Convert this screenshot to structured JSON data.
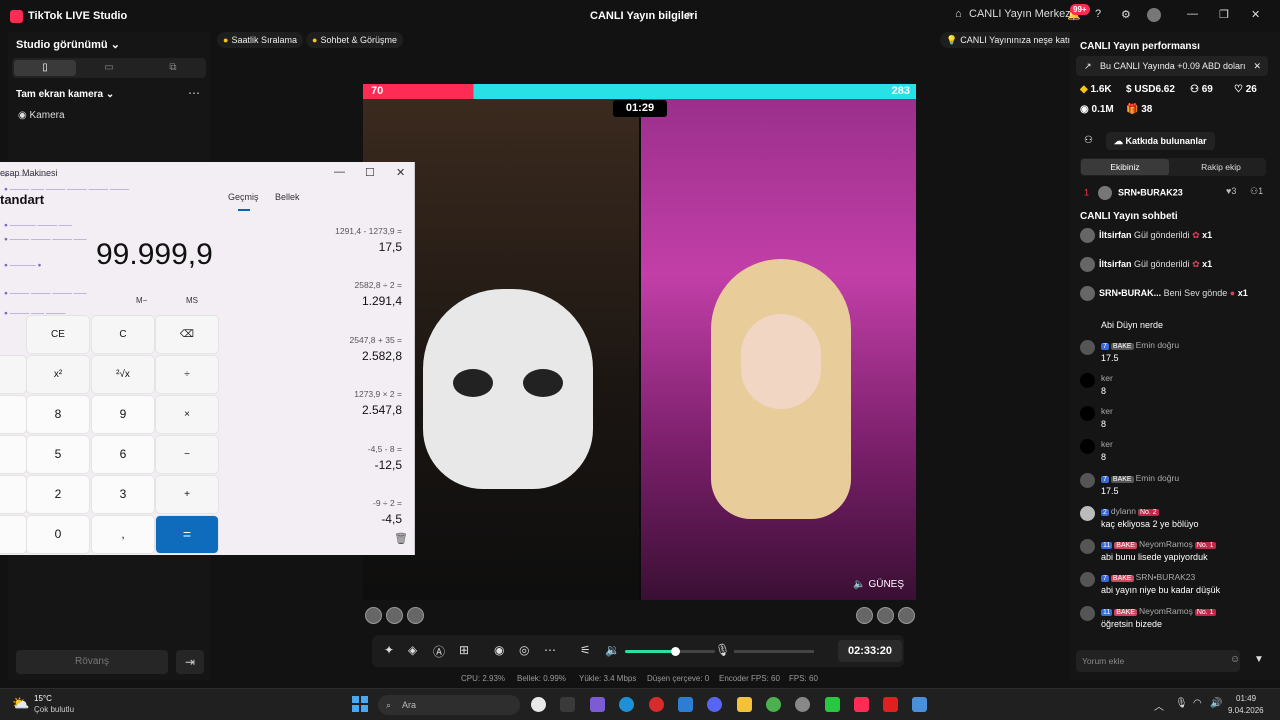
{
  "titlebar": {
    "app_name": "TikTok LIVE Studio",
    "live_info": "CANLI Yayın bilgileri",
    "edit_icon": "⇗",
    "live_center": "CANLI Yayın Merkezi",
    "notif_badge": "99+"
  },
  "left": {
    "studio_view": "Studio görünümü",
    "fullscreen_camera": "Tam ekran kamera",
    "camera_label": "Kamera",
    "rematch_button": "Rövanş"
  },
  "chips": {
    "hourly_ranking": "Saatlik Sıralama",
    "chat_meeting": "Sohbet & Görüşme",
    "tip": "CANLI Yayınınıza neşe katın"
  },
  "stage": {
    "score_left": "70",
    "score_right": "283",
    "timer": "01:29",
    "right_name": "GÜNEŞ"
  },
  "controls": {
    "volume_level": 0.55,
    "elapsed": "02:33:20"
  },
  "stats": {
    "cpu": "CPU: 2.93%",
    "memory": "Bellek: 0.99%",
    "upload": "Yükle: 3.4 Mbps",
    "dropped": "Düşen çerçeve: 0",
    "encoder_fps": "Encoder FPS: 60",
    "fps": "FPS: 60"
  },
  "right": {
    "performance_title": "CANLI Yayın performansı",
    "earnings": "Bu CANLI Yayında +0.09 ABD doları",
    "stat_coins": "1.6K",
    "stat_usd": "USD6.62",
    "stat_viewers": "69",
    "stat_likes": "26",
    "stat_views": "0.1M",
    "stat_gifts": "38",
    "contributors_button": "Katkıda bulunanlar",
    "tab_your_team": "Ekibiniz",
    "tab_rival_team": "Rakip ekip",
    "rank_num": "1",
    "rank_name": "SRN•BURAK23",
    "rank_hearts": "3",
    "rank_count": "1",
    "chat_title": "CANLI Yayın sohbeti",
    "gifts": [
      {
        "name": "İltsirfan",
        "text": "Gül gönderildi",
        "count": "x1"
      },
      {
        "name": "İltsirfan",
        "text": "Gül gönderildi",
        "count": "x1"
      },
      {
        "name": "SRN•BURAK...",
        "text": "Beni Sev gönde",
        "count": "x1"
      }
    ],
    "msg0": "Abi Düyn nerde",
    "messages": [
      {
        "level": "7",
        "tag": "BAKE",
        "user": "Emin doğru",
        "text": "17.5",
        "no": ""
      },
      {
        "level": "",
        "tag": "",
        "user": "ker",
        "text": "8",
        "no": ""
      },
      {
        "level": "",
        "tag": "",
        "user": "ker",
        "text": "8",
        "no": ""
      },
      {
        "level": "",
        "tag": "",
        "user": "ker",
        "text": "8",
        "no": ""
      },
      {
        "level": "7",
        "tag": "BAKE",
        "user": "Emin doğru",
        "text": "17.5",
        "no": ""
      },
      {
        "level": "2",
        "tag": "",
        "user": "dylann",
        "text": "kaç ekliyosa 2 ye bölüyo",
        "no": "No. 2"
      },
      {
        "level": "11",
        "tag": "BAKE",
        "user": "NeyomRamoş",
        "text": "abi bunu lisede yapiyorduk",
        "no": "No. 1"
      },
      {
        "level": "7",
        "tag": "BAKE",
        "user": "SRN•BURAK23",
        "text": "abi yayın niye bu kadar düşük",
        "no": ""
      },
      {
        "level": "11",
        "tag": "BAKE",
        "user": "NeyomRamoş",
        "text": "öğretsin bizede",
        "no": "No. 1"
      }
    ],
    "comment_placeholder": "Yorum ekle"
  },
  "calculator": {
    "title": "esap Makinesi",
    "mode": "tandart",
    "display": "99.999,9",
    "tab_history": "Geçmiş",
    "tab_memory": "Bellek",
    "mem_minus": "M−",
    "mem_store": "MS",
    "keys": {
      "ce": "CE",
      "c": "C",
      "back": "⌫",
      "sq": "x²",
      "sqrt": "²√x",
      "div": "÷",
      "k8": "8",
      "k9": "9",
      "mul": "×",
      "k5": "5",
      "k6": "6",
      "minus": "−",
      "k2": "2",
      "k3": "3",
      "plus": "+",
      "k0": "0",
      "comma": ",",
      "eq": "="
    },
    "history": [
      {
        "expr": "1291,4  -  1273,9 =",
        "result": "17,5"
      },
      {
        "expr": "2582,8  ÷  2 =",
        "result": "1.291,4"
      },
      {
        "expr": "2547,8  +  35 =",
        "result": "2.582,8"
      },
      {
        "expr": "1273,9  ×  2 =",
        "result": "2.547,8"
      },
      {
        "expr": "-4,5  -  8 =",
        "result": "-12,5"
      },
      {
        "expr": "-9  ÷  2 =",
        "result": "-4,5"
      }
    ]
  },
  "taskbar": {
    "weather_temp": "15°C",
    "weather_desc": "Çok bulutlu",
    "search_placeholder": "Ara",
    "time": "01:49",
    "date": "9.04.2026"
  }
}
